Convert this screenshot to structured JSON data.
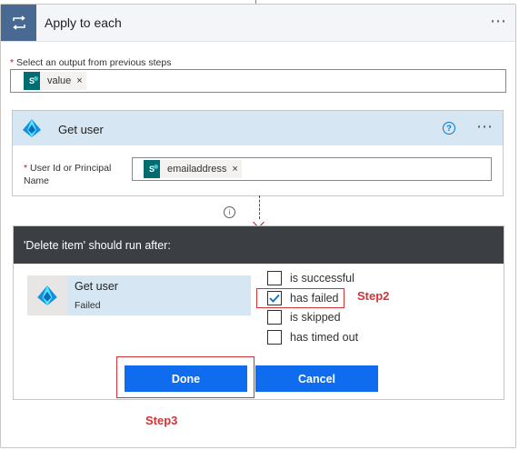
{
  "apply_to_each": {
    "title": "Apply to each",
    "select_output_label": "Select an output from previous steps",
    "required_marker": "*",
    "token": {
      "label": "value",
      "remove": "×",
      "icon": "sharepoint-icon"
    },
    "more_icon": "⋯"
  },
  "get_user": {
    "title": "Get user",
    "help_icon": "?",
    "more_icon": "⋯",
    "field_label_line1": "User Id or Principal",
    "field_label_line2": "Name",
    "required_marker": "*",
    "token": {
      "label": "emailaddress",
      "remove": "×",
      "icon": "sharepoint-icon"
    }
  },
  "connector": {
    "info_icon": "i"
  },
  "run_after": {
    "title": "'Delete item' should run after:",
    "dependency": {
      "name": "Get user",
      "status": "Failed"
    },
    "options": [
      {
        "label": "is successful",
        "checked": false
      },
      {
        "label": "has failed",
        "checked": true
      },
      {
        "label": "is skipped",
        "checked": false
      },
      {
        "label": "has timed out",
        "checked": false
      }
    ],
    "done_label": "Done",
    "cancel_label": "Cancel"
  },
  "annotations": {
    "step2": "Step2",
    "step3": "Step3"
  },
  "colors": {
    "apply_header_bg": "#f3f5f9",
    "loop_icon_bg": "#486991",
    "action_header_bg": "#d6e7f3",
    "run_after_header_bg": "#3b3f44",
    "primary_button": "#0f6cef",
    "annotation_red": "#d13438"
  }
}
